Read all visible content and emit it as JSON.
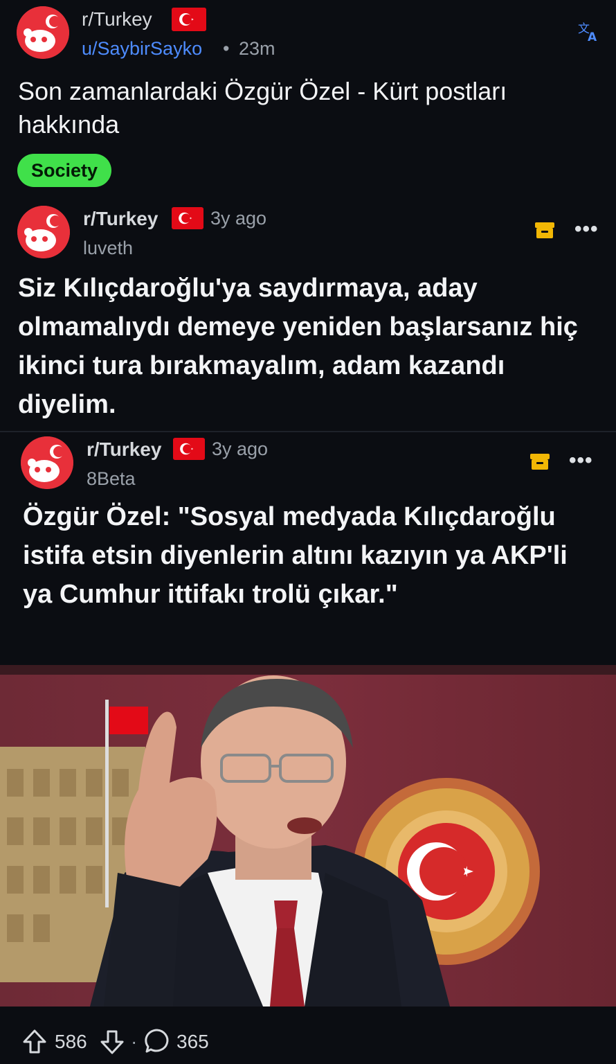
{
  "post": {
    "subreddit": "r/Turkey",
    "author": "u/SaybirSayko",
    "separator": "•",
    "time": "23m",
    "title": "Son zamanlardaki Özgür Özel - Kürt postları hakkında",
    "flair": "Society"
  },
  "crosspost_1": {
    "subreddit": "r/Turkey",
    "time": "3y ago",
    "author": "luveth",
    "title": "Siz Kılıçdaroğlu'ya saydırmaya, aday olmamalıydı demeye yeniden başlarsanız hiç ikinci tura bırakmayalım, adam kazandı diyelim."
  },
  "crosspost_2": {
    "subreddit": "r/Turkey",
    "time": "3y ago",
    "author": "8Beta",
    "title": "Özgür Özel: \"Sosyal medyada Kılıçdaroğlu istifa etsin diyenlerin altını kazıyın ya AKP'li ya Cumhur ittifakı trolü çıkar.\""
  },
  "actions": {
    "upvotes": "586",
    "separator": "·",
    "comments": "365",
    "more_label": "•••"
  },
  "colors": {
    "background": "#0b0d12",
    "flair_bg": "#40e04a",
    "link": "#4e8cff",
    "archive_icon": "#f2b705",
    "flag_red": "#e30a17"
  },
  "icons": {
    "translate": "translate-icon",
    "archive": "archive-icon",
    "upvote": "upvote-arrow-icon",
    "downvote": "downvote-arrow-icon",
    "comment": "comment-bubble-icon"
  }
}
